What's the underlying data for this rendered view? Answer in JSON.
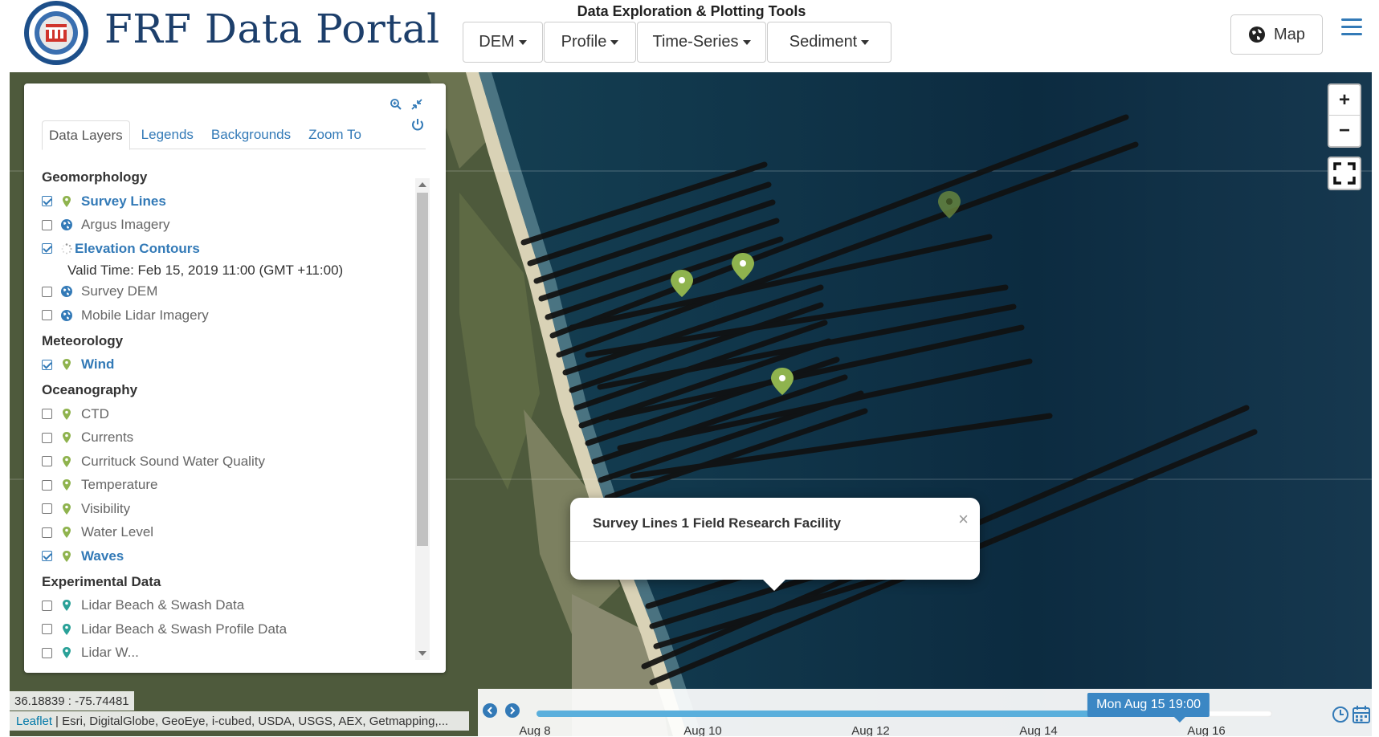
{
  "header": {
    "title": "FRF Data Portal",
    "tools_title": "Data Exploration & Plotting Tools",
    "menus": [
      {
        "label": "DEM"
      },
      {
        "label": "Profile"
      },
      {
        "label": "Time-Series"
      },
      {
        "label": "Sediment"
      }
    ],
    "map_button": "Map",
    "logo_icon": "coastal-hydraulics-laboratory-logo",
    "accent_color": "#337ab7",
    "brand_color": "#1d3f6b"
  },
  "panel": {
    "tabs": [
      {
        "label": "Data Layers",
        "active": true
      },
      {
        "label": "Legends",
        "active": false
      },
      {
        "label": "Backgrounds",
        "active": false
      },
      {
        "label": "Zoom To",
        "active": false
      }
    ],
    "groups": [
      {
        "title": "Geomorphology",
        "layers": [
          {
            "label": "Survey Lines",
            "checked": true,
            "icon": "map-pin-icon"
          },
          {
            "label": "Argus Imagery",
            "checked": false,
            "icon": "globe-icon"
          },
          {
            "label": "Elevation Contours",
            "checked": true,
            "icon": "loading-spinner-icon",
            "valid_time": "Valid Time: Feb 15, 2019 11:00 (GMT +11:00)"
          },
          {
            "label": "Survey DEM",
            "checked": false,
            "icon": "globe-icon"
          },
          {
            "label": "Mobile Lidar Imagery",
            "checked": false,
            "icon": "globe-icon"
          }
        ]
      },
      {
        "title": "Meteorology",
        "layers": [
          {
            "label": "Wind",
            "checked": true,
            "icon": "map-pin-icon"
          }
        ]
      },
      {
        "title": "Oceanography",
        "layers": [
          {
            "label": "CTD",
            "checked": false,
            "icon": "map-pin-icon"
          },
          {
            "label": "Currents",
            "checked": false,
            "icon": "map-pin-icon"
          },
          {
            "label": "Currituck Sound Water Quality",
            "checked": false,
            "icon": "map-pin-icon"
          },
          {
            "label": "Temperature",
            "checked": false,
            "icon": "map-pin-icon"
          },
          {
            "label": "Visibility",
            "checked": false,
            "icon": "map-pin-icon"
          },
          {
            "label": "Water Level",
            "checked": false,
            "icon": "map-pin-icon"
          },
          {
            "label": "Waves",
            "checked": true,
            "icon": "map-pin-icon"
          }
        ]
      },
      {
        "title": "Experimental Data",
        "layers": [
          {
            "label": "Lidar Beach & Swash Data",
            "checked": false,
            "icon": "map-pin-teal-icon"
          },
          {
            "label": "Lidar Beach & Swash Profile Data",
            "checked": false,
            "icon": "map-pin-teal-icon"
          },
          {
            "label": "Lidar W...",
            "checked": false,
            "icon": "map-pin-teal-icon"
          }
        ]
      }
    ]
  },
  "popup": {
    "title": "Survey Lines 1 Field Research Facility",
    "close": "×"
  },
  "status": {
    "coords": "36.18839 : -75.74481",
    "attribution_link": "Leaflet",
    "attribution": "| Esri, DigitalGlobe, GeoEye, i-cubed, USDA, USGS, AEX, Getmapping,..."
  },
  "timeline": {
    "current": "Mon Aug 15 19:00",
    "progress": 0.89,
    "labels": [
      "Aug 8",
      "Aug 10",
      "Aug 12",
      "Aug 14",
      "Aug 16"
    ]
  },
  "colors": {
    "marker": "#8fb34e",
    "survey_line": "#111111",
    "link": "#337ab7"
  }
}
